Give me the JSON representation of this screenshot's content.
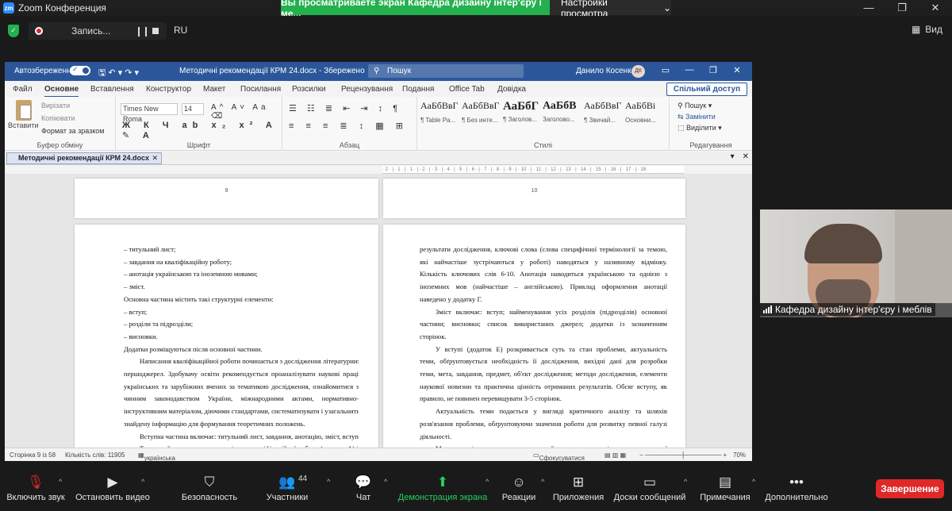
{
  "zoom": {
    "app_title": "Zoom Конференция",
    "share_banner": "Вы просматриваете экран Кафедра дизайну інтер'єру і ме...",
    "view_settings": "Настройки просмотра",
    "recording_label": "Запись...",
    "language": "RU",
    "view_label": "Вид",
    "participant_name": "Кафедра дизайну інтер'єру і меблів",
    "participant_count": "44",
    "end_label": "Завершение",
    "toolbar": [
      {
        "label": "Включить звук",
        "icon": "muted-mic-icon"
      },
      {
        "label": "Остановить видео",
        "icon": "video-camera-icon"
      },
      {
        "label": "Безопасность",
        "icon": "security-shield-icon"
      },
      {
        "label": "Участники",
        "icon": "participants-icon"
      },
      {
        "label": "Чат",
        "icon": "chat-icon"
      },
      {
        "label": "Демонстрация экрана",
        "icon": "share-screen-icon"
      },
      {
        "label": "Реакции",
        "icon": "reactions-icon"
      },
      {
        "label": "Приложения",
        "icon": "apps-icon"
      },
      {
        "label": "Доски сообщений",
        "icon": "whiteboard-icon"
      },
      {
        "label": "Примечания",
        "icon": "notes-icon"
      },
      {
        "label": "Дополнительно",
        "icon": "more-icon"
      }
    ]
  },
  "word": {
    "autosave": "Автозбереження",
    "doc_title": "Методичні рекомендації КРМ 24.docx - Збережено",
    "search_placeholder": "Пошук",
    "user_name": "Данило Косенко",
    "user_initials": "ДК",
    "menu": [
      "Файл",
      "Основне",
      "Вставлення",
      "Конструктор",
      "Макет",
      "Посилання",
      "Розсилки",
      "Рецензування",
      "Подання",
      "Office Tab",
      "Довідка"
    ],
    "active_menu": "Основне",
    "share_button": "Спільний доступ",
    "clipboard": {
      "paste": "Вставити",
      "cut": "Вирізати",
      "copy": "Копіювати",
      "format_painter": "Формат за зразком",
      "group": "Буфер обміну"
    },
    "font": {
      "name": "Times New Roma",
      "size": "14",
      "group": "Шрифт"
    },
    "paragraph_group": "Абзац",
    "styles": [
      {
        "preview": "АаБбВвГ",
        "name": "¶ Table Pa..."
      },
      {
        "preview": "АаБбВвГ",
        "name": "¶ Без инте..."
      },
      {
        "preview": "АаБбГ",
        "name": "¶ Заголов..."
      },
      {
        "preview": "АаБбВ",
        "name": "Заголово..."
      },
      {
        "preview": "АаБбВвГ",
        "name": "¶ Звичай..."
      },
      {
        "preview": "АаБбВі",
        "name": "Основни..."
      }
    ],
    "styles_group": "Стилі",
    "editing": {
      "find": "Пошук",
      "replace": "Замінити",
      "select": "Виділити",
      "group": "Редагування"
    },
    "doc_tab": "Методичні рекомендації КРМ 24.docx",
    "page_numbers": [
      "9",
      "10"
    ],
    "ruler": "· 2 · | · 1 · | · 1 · | · 2 · | · 3 · | · 4 · | · 5 · | · 6 · | · 7 · | · 8 · | · 9 · | · 10 · | · 11 · | · 12 · | · 13 · | · 14 · | · 15 · | · 16 · | · 17 · | · 18 ·",
    "left_page": [
      {
        "t": "–   титульний лист;",
        "c": "bullet"
      },
      {
        "t": "–   завдання на кваліфікаційну роботу;",
        "c": "bullet"
      },
      {
        "t": "–   анотація українською та іноземною мовами;",
        "c": "bullet"
      },
      {
        "t": "–   зміст.",
        "c": "bullet"
      },
      {
        "t": "Основна частина містить такі структурні елементи:",
        "c": "plain"
      },
      {
        "t": "–   вступ;",
        "c": "bullet"
      },
      {
        "t": "–   розділи та підрозділи;",
        "c": "bullet"
      },
      {
        "t": "–   висновки.",
        "c": "bullet"
      },
      {
        "t": "Додатки розміщуються після основної частини.",
        "c": "plain"
      },
      {
        "t": "Написання кваліфікаційної роботи починається з дослідження літературних",
        "c": "just ind"
      },
      {
        "t": "першоджерел. Здобувачу освіти рекомендується проаналізувати наукові праці",
        "c": "just"
      },
      {
        "t": "українських та зарубіжних вчених за тематикою дослідження, ознайомитися з",
        "c": "just"
      },
      {
        "t": "чинним законодавством України, міжнародними актами, нормативно-",
        "c": "just"
      },
      {
        "t": "інструктивним матеріалом, діючими стандартами, систематизувати і узагальнити",
        "c": "just"
      },
      {
        "t": "знайдену інформацію для формування теоретичних положень.",
        "c": "plain"
      },
      {
        "t": "Вступна частина включає: титульний лист, завдання, анотацію, зміст, вступ.",
        "c": "just ind"
      },
      {
        "t": "Титульний лист є першою сторінкою кваліфікаційної роботи (додаток А) і",
        "c": "just ind"
      }
    ],
    "right_page": [
      {
        "t": "результати дослідження, ключові слова (слова специфічної термінології за темою,",
        "c": "just"
      },
      {
        "t": "які найчастіше зустрічаються у роботі) наводяться у називному відмінку.",
        "c": "just"
      },
      {
        "t": "Кількість ключових слів 6-10. Анотація наводиться українською та однією з",
        "c": "just"
      },
      {
        "t": "іноземних мов (найчастіше – англійською). Приклад оформлення анотації",
        "c": "just"
      },
      {
        "t": "наведено у додатку Г.",
        "c": "plain"
      },
      {
        "t": "Зміст включає: вступ; найменування усіх розділів (підрозділів) основної",
        "c": "just ind"
      },
      {
        "t": "частини; висновки; список використаних джерел; додатки із зазначенням",
        "c": "just"
      },
      {
        "t": "сторінок.",
        "c": "plain"
      },
      {
        "t": "У вступі (додаток Е) розкривається суть та стан проблеми, актуальність",
        "c": "just ind"
      },
      {
        "t": "теми, обґрунтовується необхідність її дослідження, вихідні дані для розробки",
        "c": "just"
      },
      {
        "t": "теми, мета, завдання, предмет, об'єкт дослідження; методи дослідження, елементи",
        "c": "just"
      },
      {
        "t": "наукової новизни та практична цінність отриманих результатів. Обсяг вступу, як",
        "c": "just"
      },
      {
        "t": "правило, не повинен перевищувати 3-5 сторінок.",
        "c": "plain"
      },
      {
        "t": "Актуальність теми подається у вигляді критичного аналізу та шляхів",
        "c": "just ind"
      },
      {
        "t": "розв'язання проблеми, обґрунтовуючи значення роботи для розвитку певної галузі",
        "c": "just"
      },
      {
        "t": "діяльності.",
        "c": "plain"
      },
      {
        "t": "Мета дослідження – запланований результат вирішення визначеної",
        "c": "just ind"
      }
    ],
    "status": {
      "page": "Сторінка 9 із 58",
      "words": "Кількість слів: 11905",
      "lang": "українська",
      "focus": "Сфокусуватися",
      "zoom": "70%"
    }
  }
}
